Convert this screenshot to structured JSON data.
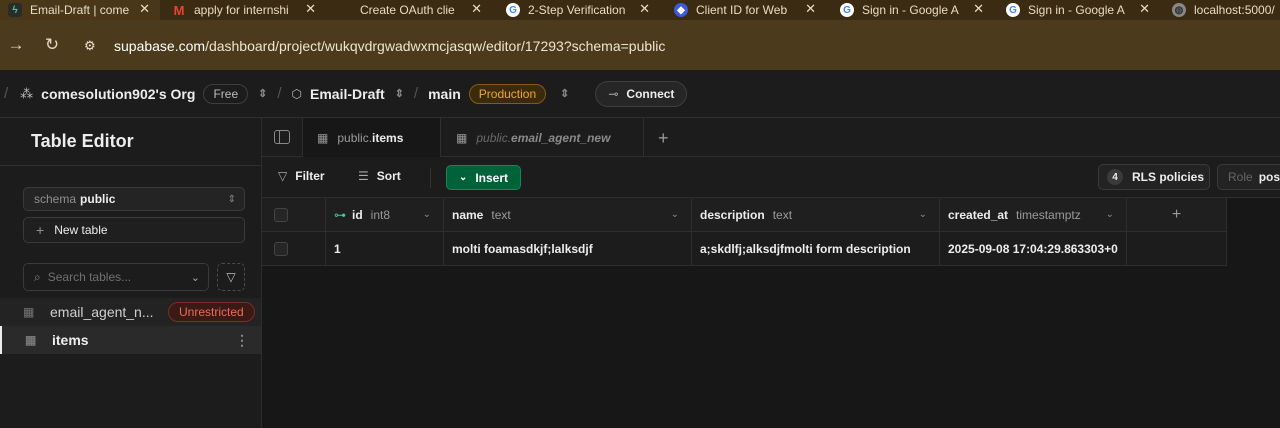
{
  "browser": {
    "tabs": [
      {
        "title": "Email-Draft | come",
        "favicon": "supabase-icon",
        "active": true
      },
      {
        "title": "apply for internshi",
        "favicon": "gmail-icon"
      },
      {
        "title": "Create OAuth clie",
        "favicon": "blank-icon"
      },
      {
        "title": "2-Step Verification",
        "favicon": "google-icon"
      },
      {
        "title": "Client ID for Web",
        "favicon": "shield-icon"
      },
      {
        "title": "Sign in - Google A",
        "favicon": "google-icon"
      },
      {
        "title": "Sign in - Google A",
        "favicon": "google-icon"
      },
      {
        "title": "localhost:5000/",
        "favicon": "globe-icon"
      }
    ],
    "url_host": "supabase.com",
    "url_path": "/dashboard/project/wukqvdrgwadwxmcjasqw/editor/17293?schema=public"
  },
  "topnav": {
    "org": "comesolution902's Org",
    "org_plan": "Free",
    "project": "Email-Draft",
    "branch": "main",
    "branch_badge": "Production",
    "connect_label": "Connect"
  },
  "sidebar": {
    "title": "Table Editor",
    "schema_prefix": "schema",
    "schema_value": "public",
    "new_table_label": "New table",
    "search_placeholder": "Search tables...",
    "tables": [
      {
        "name": "email_agent_n...",
        "badge": "Unrestricted"
      },
      {
        "name": "items",
        "selected": true
      }
    ]
  },
  "editor": {
    "tabs": [
      {
        "schema": "public.",
        "table": "items",
        "active": true
      },
      {
        "schema": "public.",
        "table": "email_agent_new",
        "active": false
      }
    ],
    "toolbar": {
      "filter_label": "Filter",
      "sort_label": "Sort",
      "insert_label": "Insert",
      "rls_count": "4",
      "rls_label": "RLS policies",
      "role_prefix": "Role",
      "role_value": "post"
    },
    "columns": [
      {
        "name": "id",
        "type": "int8",
        "primary_key": true
      },
      {
        "name": "name",
        "type": "text"
      },
      {
        "name": "description",
        "type": "text"
      },
      {
        "name": "created_at",
        "type": "timestamptz"
      }
    ],
    "rows": [
      {
        "id": "1",
        "name": "molti foamasdkjf;lalksdjf",
        "description": "a;skdlfj;alksdjfmolti form description",
        "created_at": "2025-09-08 17:04:29.863303+0"
      }
    ]
  }
}
